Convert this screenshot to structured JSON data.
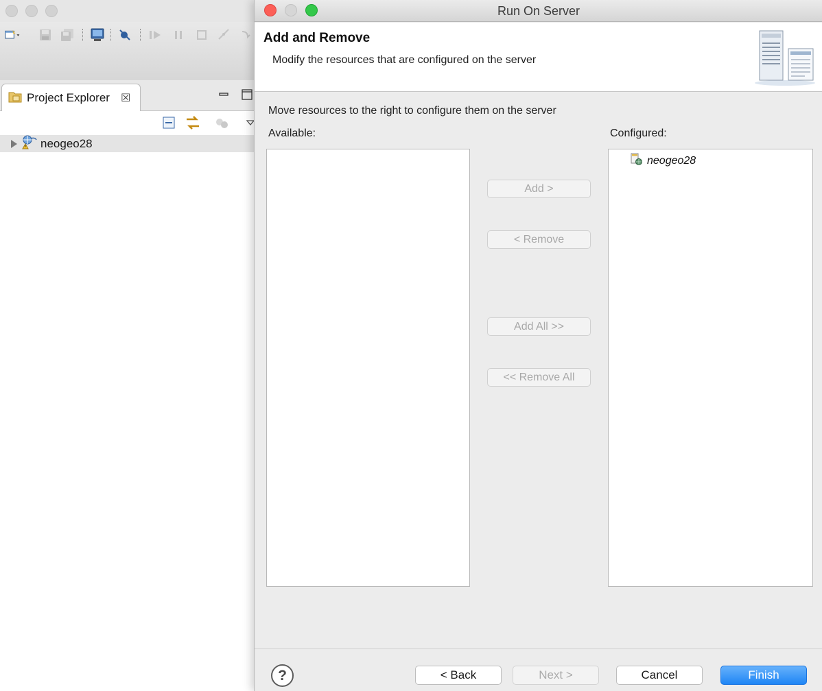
{
  "background_window": {
    "view_tab": {
      "label": "Project Explorer",
      "icon": "project-explorer-icon",
      "close_glyph": "☒"
    },
    "tree": {
      "items": [
        {
          "label": "neogeo28",
          "icon": "web-project-icon"
        }
      ]
    }
  },
  "dialog": {
    "title": "Run On Server",
    "header": {
      "title": "Add and Remove",
      "description": "Modify the resources that are configured on the server",
      "image": "server-wizard-icon"
    },
    "instruction": "Move resources to the right to configure them on the server",
    "available": {
      "label": "Available:",
      "items": []
    },
    "configured": {
      "label": "Configured:",
      "items": [
        {
          "label": "neogeo28",
          "icon": "module-icon"
        }
      ]
    },
    "move_buttons": {
      "add": "Add >",
      "remove": "< Remove",
      "add_all": "Add All >>",
      "remove_all": "<< Remove All"
    },
    "footer": {
      "help": "?",
      "back": "< Back",
      "next": "Next >",
      "cancel": "Cancel",
      "finish": "Finish"
    }
  },
  "colors": {
    "finish_button": "#1f86f5",
    "close_traffic_light": "#fc5f57",
    "zoom_traffic_light": "#34c84a",
    "disabled_text": "#a8a8a8"
  }
}
